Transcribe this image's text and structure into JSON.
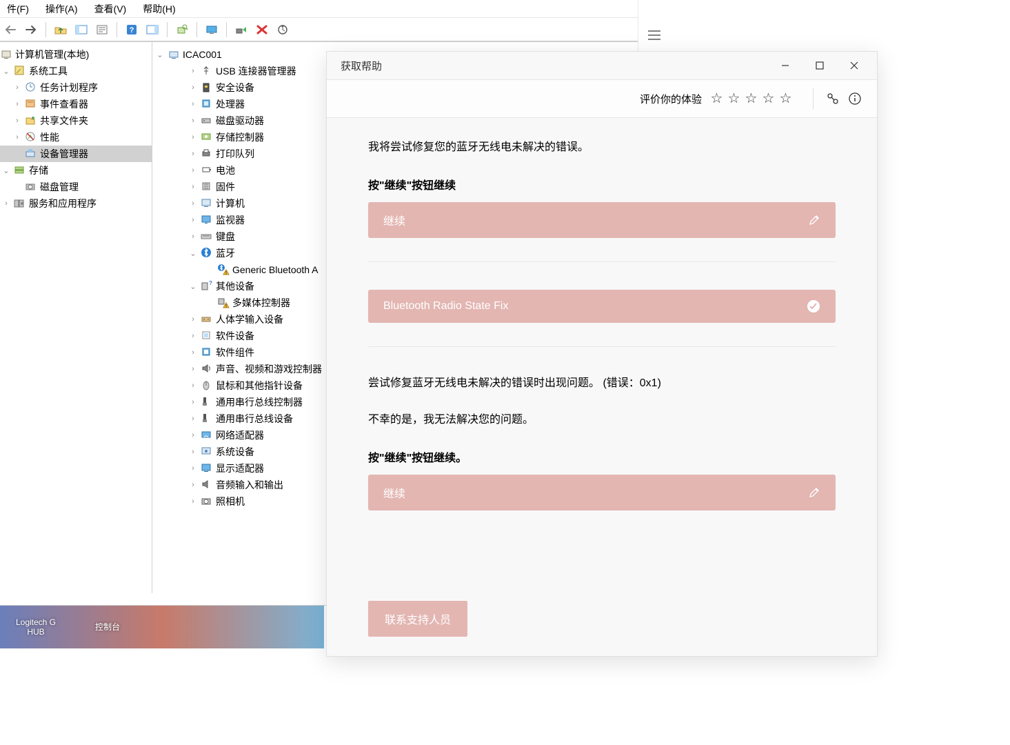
{
  "menu": [
    "件(F)",
    "操作(A)",
    "查看(V)",
    "帮助(H)"
  ],
  "left_tree": {
    "root": "计算机管理(本地)",
    "items": [
      {
        "label": "系统工具",
        "indent": 2,
        "exp": "v",
        "icon": "wrench"
      },
      {
        "label": "任务计划程序",
        "indent": 3,
        "exp": ">",
        "icon": "clock"
      },
      {
        "label": "事件查看器",
        "indent": 3,
        "exp": ">",
        "icon": "event"
      },
      {
        "label": "共享文件夹",
        "indent": 3,
        "exp": ">",
        "icon": "share"
      },
      {
        "label": "性能",
        "indent": 3,
        "exp": ">",
        "icon": "perf"
      },
      {
        "label": "设备管理器",
        "indent": 3,
        "exp": "",
        "icon": "devmgr",
        "selected": true
      },
      {
        "label": "存储",
        "indent": 2,
        "exp": "v",
        "icon": "storage"
      },
      {
        "label": "磁盘管理",
        "indent": 3,
        "exp": "",
        "icon": "disk"
      },
      {
        "label": "服务和应用程序",
        "indent": 2,
        "exp": ">",
        "icon": "services"
      }
    ]
  },
  "dev_tree": {
    "root": "ICAC001",
    "items": [
      {
        "label": "USB 连接器管理器",
        "indent": 3,
        "exp": ">",
        "icon": "usb"
      },
      {
        "label": "安全设备",
        "indent": 3,
        "exp": ">",
        "icon": "security"
      },
      {
        "label": "处理器",
        "indent": 3,
        "exp": ">",
        "icon": "cpu"
      },
      {
        "label": "磁盘驱动器",
        "indent": 3,
        "exp": ">",
        "icon": "hdd"
      },
      {
        "label": "存储控制器",
        "indent": 3,
        "exp": ">",
        "icon": "storagectrl"
      },
      {
        "label": "打印队列",
        "indent": 3,
        "exp": ">",
        "icon": "printer"
      },
      {
        "label": "电池",
        "indent": 3,
        "exp": ">",
        "icon": "battery"
      },
      {
        "label": "固件",
        "indent": 3,
        "exp": ">",
        "icon": "firmware"
      },
      {
        "label": "计算机",
        "indent": 3,
        "exp": ">",
        "icon": "pc"
      },
      {
        "label": "监视器",
        "indent": 3,
        "exp": ">",
        "icon": "monitor"
      },
      {
        "label": "键盘",
        "indent": 3,
        "exp": ">",
        "icon": "keyboard"
      },
      {
        "label": "蓝牙",
        "indent": 3,
        "exp": "v",
        "icon": "bluetooth"
      },
      {
        "label": "Generic Bluetooth A",
        "indent": 4,
        "exp": "",
        "icon": "bt-warn"
      },
      {
        "label": "其他设备",
        "indent": 3,
        "exp": "v",
        "icon": "other"
      },
      {
        "label": "多媒体控制器",
        "indent": 4,
        "exp": "",
        "icon": "mm-warn"
      },
      {
        "label": "人体学输入设备",
        "indent": 3,
        "exp": ">",
        "icon": "hid"
      },
      {
        "label": "软件设备",
        "indent": 3,
        "exp": ">",
        "icon": "softdev"
      },
      {
        "label": "软件组件",
        "indent": 3,
        "exp": ">",
        "icon": "softcomp"
      },
      {
        "label": "声音、视频和游戏控制器",
        "indent": 3,
        "exp": ">",
        "icon": "audio"
      },
      {
        "label": "鼠标和其他指针设备",
        "indent": 3,
        "exp": ">",
        "icon": "mouse"
      },
      {
        "label": "通用串行总线控制器",
        "indent": 3,
        "exp": ">",
        "icon": "usbctrl"
      },
      {
        "label": "通用串行总线设备",
        "indent": 3,
        "exp": ">",
        "icon": "usbdev"
      },
      {
        "label": "网络适配器",
        "indent": 3,
        "exp": ">",
        "icon": "network"
      },
      {
        "label": "系统设备",
        "indent": 3,
        "exp": ">",
        "icon": "system"
      },
      {
        "label": "显示适配器",
        "indent": 3,
        "exp": ">",
        "icon": "display"
      },
      {
        "label": "音频输入和输出",
        "indent": 3,
        "exp": ">",
        "icon": "audioio"
      },
      {
        "label": "照相机",
        "indent": 3,
        "exp": ">",
        "icon": "camera"
      }
    ]
  },
  "gethelp": {
    "title": "获取帮助",
    "rate_label": "评价你的体验",
    "msg1": "我将尝试修复您的蓝牙无线电未解决的错误。",
    "press_continue": "按\"继续\"按钮继续",
    "continue_label": "继续",
    "fix_title": "Bluetooth Radio State Fix",
    "error_msg": "尝试修复蓝牙无线电未解决的错误时出现问题。  (错误：0x1)",
    "sorry_msg": "不幸的是，我无法解决您的问题。",
    "press_continue2": "按\"继续\"按钮继续。",
    "contact": "联系支持人员"
  },
  "taskbar": {
    "t1a": "Logitech G",
    "t1b": "HUB",
    "t2a": "",
    "t2b": "控制台"
  }
}
